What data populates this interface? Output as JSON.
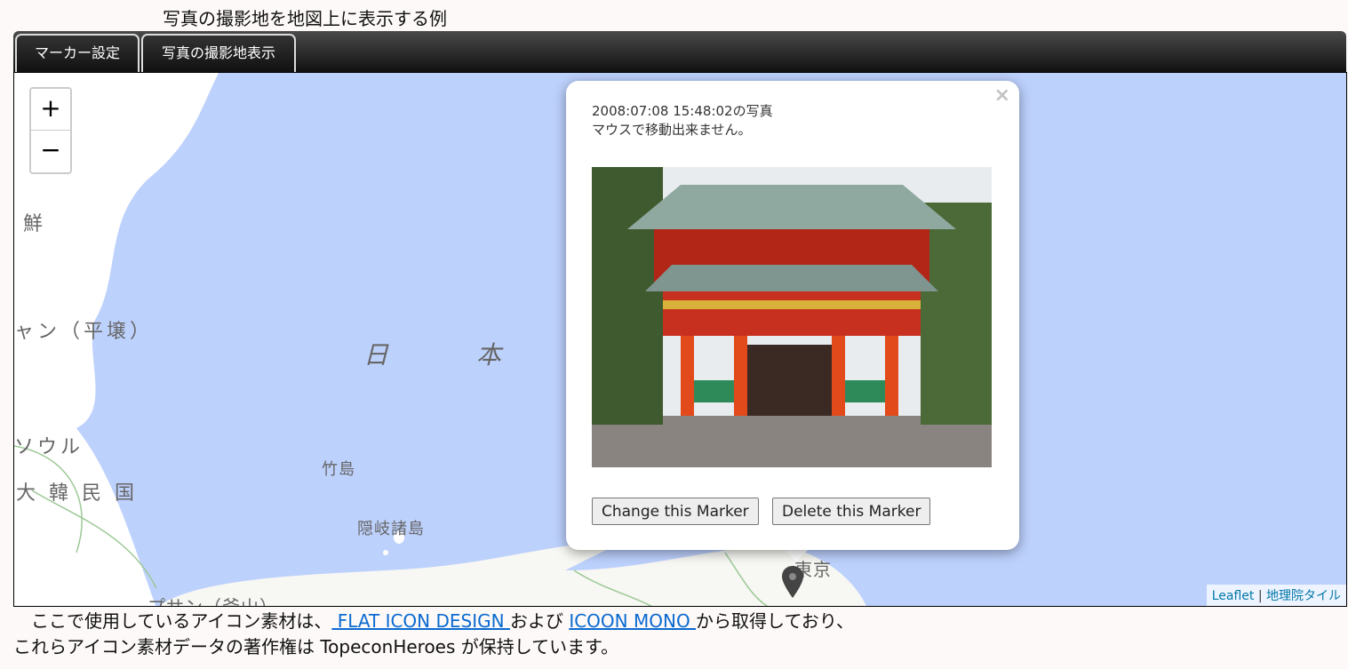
{
  "page_title": "写真の撮影地を地図上に表示する例",
  "tabs": [
    {
      "label": "マーカー設定"
    },
    {
      "label": "写真の撮影地表示"
    }
  ],
  "map": {
    "zoom_in": "+",
    "zoom_out": "−",
    "labels": {
      "l1": "鮮",
      "l2": "ャン（平壌）",
      "l3": "日",
      "l4": "本",
      "l5": "ソウル",
      "l6": "大 韓 民 国",
      "l7": "竹島",
      "l8": "隠岐諸島",
      "l9": "東京",
      "l10": "プサン（釜山）"
    },
    "attribution": {
      "leaflet": "Leaflet",
      "sep": " | ",
      "gsi": "地理院タイル"
    },
    "marker_icon": "map-pin-icon"
  },
  "popup": {
    "close": "×",
    "line1": "2008:07:08 15:48:02の写真",
    "line2": "マウスで移動出来ません。",
    "change_button": "Change this Marker",
    "delete_button": "Delete this Marker"
  },
  "footer": {
    "t1": "　ここで使用しているアイコン素材は、",
    "link1": " FLAT ICON DESIGN ",
    "t2": "および",
    "link2": "ICOON MONO ",
    "t3": "から取得しており、",
    "t4": "これらアイコン素材データの著作権は TopeconHeroes が保持しています。"
  }
}
